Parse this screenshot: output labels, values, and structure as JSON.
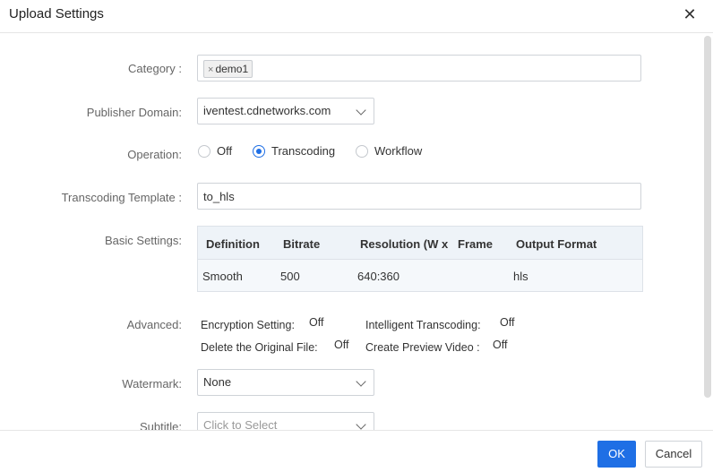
{
  "dialog": {
    "title": "Upload Settings",
    "close_glyph": "✕"
  },
  "form": {
    "category": {
      "label": "Category :",
      "tags": [
        "demo1"
      ],
      "tag_remove_glyph": "×"
    },
    "publisher_domain": {
      "label": "Publisher Domain:",
      "value": "iventest.cdnetworks.com"
    },
    "operation": {
      "label": "Operation:",
      "options": [
        "Off",
        "Transcoding",
        "Workflow"
      ],
      "selected": "Transcoding"
    },
    "transcoding_template": {
      "label": "Transcoding Template :",
      "value": "to_hls"
    },
    "basic_settings": {
      "label": "Basic Settings:",
      "columns": [
        "Definition",
        "Bitrate",
        "Resolution (W x",
        "Frame",
        "Output Format"
      ],
      "rows": [
        [
          "Smooth",
          "500",
          "640:360",
          "",
          "hls"
        ]
      ]
    },
    "advanced": {
      "label": "Advanced:",
      "items": [
        {
          "name": "Encryption Setting:",
          "value": "Off"
        },
        {
          "name": "Intelligent Transcoding:",
          "value": "Off"
        },
        {
          "name": "Delete the Original File:",
          "value": "Off"
        },
        {
          "name": "Create Preview Video :",
          "value": "Off"
        }
      ]
    },
    "watermark": {
      "label": "Watermark:",
      "value": "None"
    },
    "subtitle": {
      "label": "Subtitle:",
      "placeholder": "Click to Select"
    }
  },
  "footer": {
    "ok_label": "OK",
    "cancel_label": "Cancel"
  },
  "colors": {
    "primary": "#1f6fe5",
    "table_header_bg": "#eef3f8"
  }
}
